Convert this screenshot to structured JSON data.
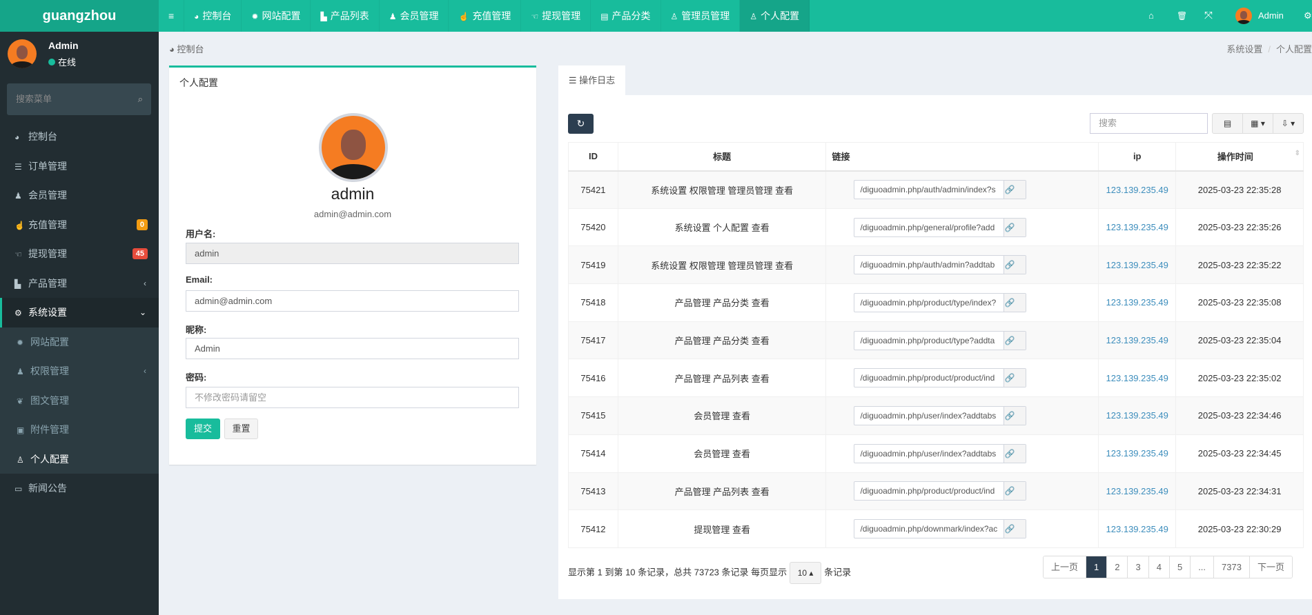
{
  "brand": "guangzhou",
  "topnav": {
    "toggle_icon": "≡",
    "items": [
      {
        "label": "控制台",
        "icon": "dashboard-icon",
        "glyph": "◕"
      },
      {
        "label": "网站配置",
        "icon": "gear-icon",
        "glyph": "✹"
      },
      {
        "label": "产品列表",
        "icon": "shopping-bag-icon",
        "glyph": "▙"
      },
      {
        "label": "会员管理",
        "icon": "users-icon",
        "glyph": "♟"
      },
      {
        "label": "充值管理",
        "icon": "hand-pointer-icon",
        "glyph": "☝"
      },
      {
        "label": "提现管理",
        "icon": "hand-point-left-icon",
        "glyph": "☜"
      },
      {
        "label": "产品分类",
        "icon": "list-alt-icon",
        "glyph": "▤"
      },
      {
        "label": "管理员管理",
        "icon": "user-icon",
        "glyph": "♙"
      },
      {
        "label": "个人配置",
        "icon": "user-icon",
        "glyph": "♙",
        "active": true
      }
    ],
    "right": {
      "home": "⌂",
      "trash": "🗑",
      "expand": "⤧",
      "user": "Admin",
      "gear": "⚙"
    }
  },
  "sidebar": {
    "user": "Admin",
    "status": "在线",
    "search_placeholder": "搜索菜单",
    "search_icon": "⌕",
    "items": [
      {
        "label": "控制台",
        "glyph": "◕"
      },
      {
        "label": "订单管理",
        "glyph": "☰"
      },
      {
        "label": "会员管理",
        "glyph": "♟"
      },
      {
        "label": "充值管理",
        "glyph": "☝",
        "badge": "0",
        "badge_color": "#f39c12"
      },
      {
        "label": "提现管理",
        "glyph": "☜",
        "badge": "45",
        "badge_color": "#e74c3c"
      },
      {
        "label": "产品管理",
        "glyph": "▙",
        "caret": "‹"
      },
      {
        "label": "系统设置",
        "glyph": "⚙",
        "caret": "⌄"
      },
      {
        "label": "网站配置",
        "glyph": "✹"
      },
      {
        "label": "权限管理",
        "glyph": "♟",
        "caret": "‹"
      },
      {
        "label": "图文管理",
        "glyph": "❦"
      },
      {
        "label": "附件管理",
        "glyph": "▣"
      },
      {
        "label": "个人配置",
        "glyph": "♙"
      },
      {
        "label": "新闻公告",
        "glyph": "▭"
      }
    ]
  },
  "breadcrumb": {
    "left": "控制台",
    "left_icon": "◕",
    "right": [
      "系统设置",
      "个人配置"
    ],
    "sep": "/"
  },
  "profile": {
    "title": "个人配置",
    "name": "admin",
    "email": "admin@admin.com",
    "username_label": "用户名:",
    "username": "admin",
    "email_label": "Email:",
    "email_value": "admin@admin.com",
    "nickname_label": "昵称:",
    "nickname": "Admin",
    "password_label": "密码:",
    "password_placeholder": "不修改密码请留空",
    "submit": "提交",
    "reset": "重置"
  },
  "log": {
    "tab": "操作日志",
    "tab_icon": "☰",
    "refresh_icon": "↻",
    "search_placeholder": "搜索",
    "toolbar": [
      "▤",
      "▦ ▾",
      "⇩ ▾"
    ],
    "columns": [
      "ID",
      "标题",
      "链接",
      "ip",
      "操作时间"
    ],
    "link_icon": "🔗",
    "rows": [
      [
        "75421",
        "系统设置 权限管理 管理员管理 查看",
        "/diguoadmin.php/auth/admin/index?s",
        "123.139.235.49",
        "2025-03-23 22:35:28"
      ],
      [
        "75420",
        "系统设置 个人配置 查看",
        "/diguoadmin.php/general/profile?add",
        "123.139.235.49",
        "2025-03-23 22:35:26"
      ],
      [
        "75419",
        "系统设置 权限管理 管理员管理 查看",
        "/diguoadmin.php/auth/admin?addtab",
        "123.139.235.49",
        "2025-03-23 22:35:22"
      ],
      [
        "75418",
        "产品管理 产品分类 查看",
        "/diguoadmin.php/product/type/index?",
        "123.139.235.49",
        "2025-03-23 22:35:08"
      ],
      [
        "75417",
        "产品管理 产品分类 查看",
        "/diguoadmin.php/product/type?addta",
        "123.139.235.49",
        "2025-03-23 22:35:04"
      ],
      [
        "75416",
        "产品管理 产品列表 查看",
        "/diguoadmin.php/product/product/ind",
        "123.139.235.49",
        "2025-03-23 22:35:02"
      ],
      [
        "75415",
        "会员管理 查看",
        "/diguoadmin.php/user/index?addtabs",
        "123.139.235.49",
        "2025-03-23 22:34:46"
      ],
      [
        "75414",
        "会员管理 查看",
        "/diguoadmin.php/user/index?addtabs",
        "123.139.235.49",
        "2025-03-23 22:34:45"
      ],
      [
        "75413",
        "产品管理 产品列表 查看",
        "/diguoadmin.php/product/product/ind",
        "123.139.235.49",
        "2025-03-23 22:34:31"
      ],
      [
        "75412",
        "提现管理 查看",
        "/diguoadmin.php/downmark/index?ac",
        "123.139.235.49",
        "2025-03-23 22:30:29"
      ]
    ],
    "footer_pre": "显示第 1 到第 10 条记录，总共 73723 条记录 每页显示",
    "page_size": "10 ▴",
    "footer_post": "条记录",
    "pages": [
      "上一页",
      "1",
      "2",
      "3",
      "4",
      "5",
      "...",
      "7373",
      "下一页"
    ],
    "current_page": "1"
  },
  "colors": {
    "accent": "#18bc9c",
    "sidebar": "#222d32",
    "dark_button": "#2c3e50",
    "link": "#3c8dbc"
  }
}
